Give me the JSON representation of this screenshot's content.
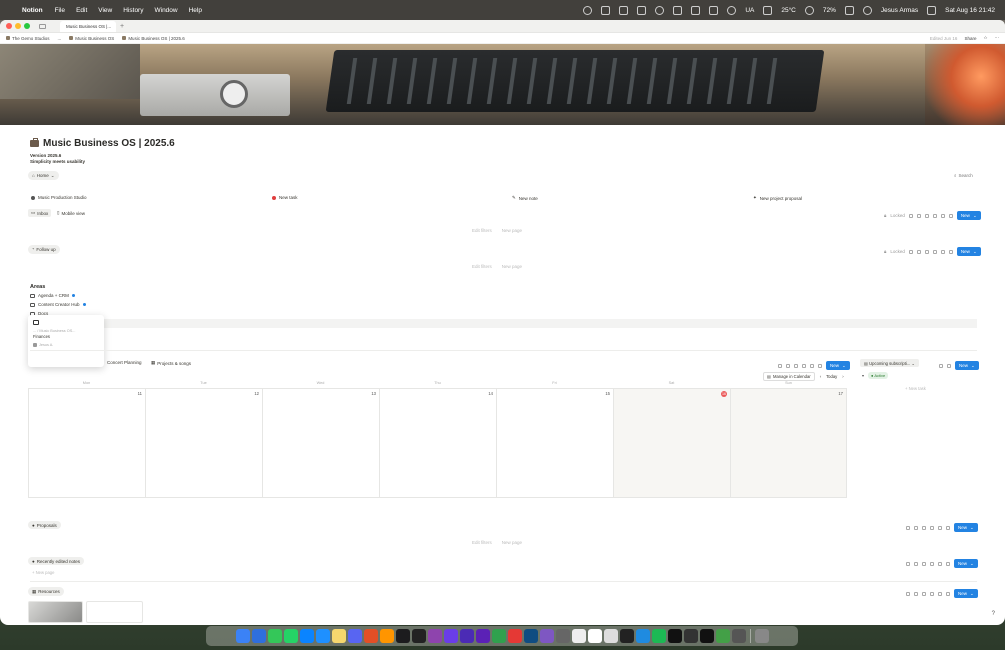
{
  "menubar": {
    "app_name": "Notion",
    "menus": [
      "File",
      "Edit",
      "View",
      "History",
      "Window",
      "Help"
    ],
    "input_source": "UA",
    "weather": "25°C",
    "battery": "72%",
    "user": "Jesus Armas",
    "datetime": "Sat Aug 16  21:42"
  },
  "browser": {
    "tab_title": "Music Business OS |...",
    "breadcrumbs": [
      "The Gemo Studios",
      "...",
      "Music Business OS",
      "Music Business OS | 2025.6"
    ],
    "edited": "Edited Jun 16",
    "share_label": "Share"
  },
  "page": {
    "title": "Music Business OS | 2025.6",
    "version": "Version 2025.6",
    "tagline": "Simplicity meets usability",
    "home_label": "Home",
    "search_label": "Search",
    "quick_links": [
      "Music Production Studio",
      "New task",
      "New note",
      "New project proposal"
    ]
  },
  "inbox": {
    "views": [
      "Inbox",
      "Mobile view"
    ],
    "locked": "Locked",
    "new_label": "New",
    "edit_filters": "Edit filters",
    "new_page": "New page"
  },
  "follow_up": {
    "label": "Follow up",
    "locked": "Locked",
    "new_label": "New",
    "edit_filters": "Edit filters",
    "new_page": "New page"
  },
  "areas": {
    "title": "Areas",
    "items": [
      "Agenda + CRM",
      "Content Creator Hub",
      "Docs",
      "Finances"
    ]
  },
  "hover_card": {
    "path": "... / Music Business OS...",
    "title": "Finances",
    "person": "Jesus A."
  },
  "calendar": {
    "views": [
      "Concert Planning",
      "Projects & songs"
    ],
    "new_label": "New",
    "manage_label": "Manage in Calendar",
    "today_label": "Today",
    "days": [
      "Mon",
      "Tue",
      "Wed",
      "Thu",
      "Fri",
      "Sat",
      "Sun"
    ],
    "dates": [
      "11",
      "12",
      "13",
      "14",
      "15",
      "16",
      "17"
    ],
    "today_index": 5
  },
  "subscriptions": {
    "tab": "Upcoming subscripti...",
    "new_label": "New",
    "active_label": "Active",
    "new_task": "New task"
  },
  "proposals": {
    "label": "Proposals",
    "new_label": "New",
    "edit_filters": "Edit filters",
    "new_page": "New page"
  },
  "recent_notes": {
    "label": "Recently edited notes",
    "new_label": "New",
    "new_page": "New page"
  },
  "resources": {
    "label": "Resources",
    "new_label": "New"
  },
  "colors": {
    "accent": "#2383e2",
    "today": "#eb5757",
    "active_green": "#2e7d32"
  }
}
